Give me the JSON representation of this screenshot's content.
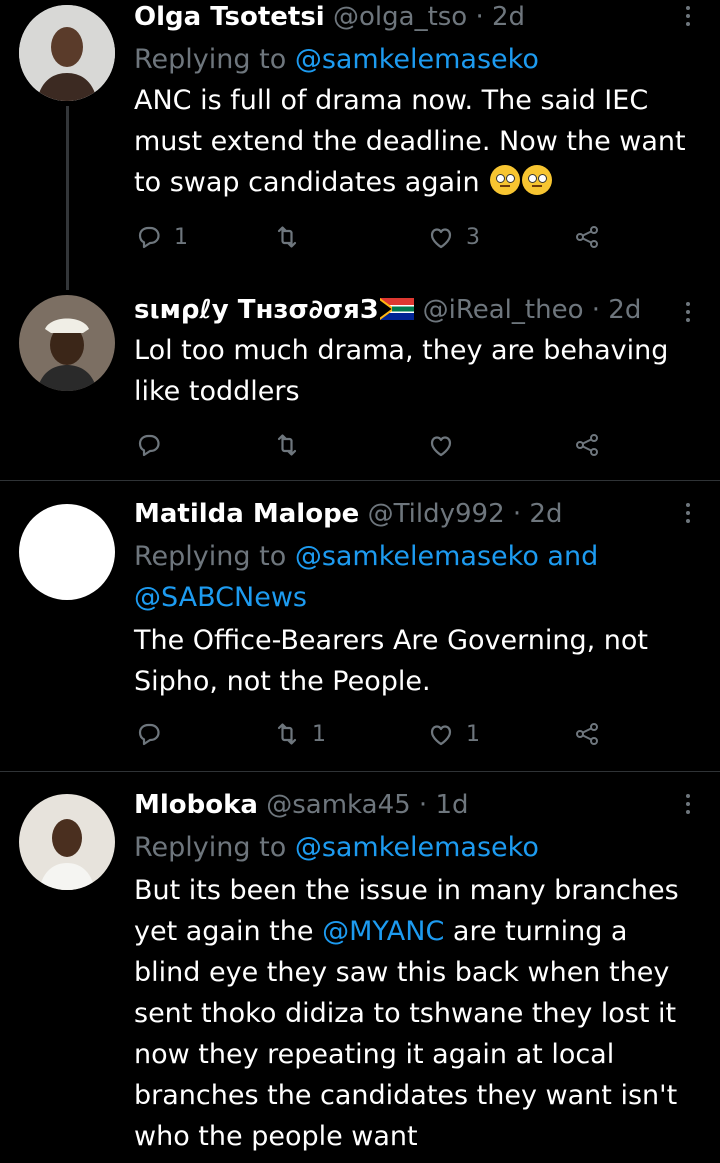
{
  "tweets": [
    {
      "name": "Olga Tsotetsi",
      "handle": "@olga_tso",
      "time": "· 2d",
      "reply_prefix": "Replying to",
      "reply_to": "@samkelemaseko",
      "text": "ANC is full of drama now. The said IEC must extend the deadline. Now the want to swap candidates again",
      "replies": "1",
      "retweets": "",
      "likes": "3"
    },
    {
      "name": "sιмρℓу Tнзσ∂σяЗ",
      "handle": "@iReal_theo",
      "time": "· 2d",
      "text": "Lol too much drama, they are behaving like toddlers",
      "replies": "",
      "retweets": "",
      "likes": ""
    },
    {
      "name": "Matilda Malope",
      "handle": "@Tildy992",
      "time": "· 2d",
      "reply_prefix": "Replying to",
      "reply_to": "@samkelemaseko and @SABCNews",
      "text": "The Office-Bearers Are Governing, not Sipho, not the People.",
      "replies": "",
      "retweets": "1",
      "likes": "1"
    },
    {
      "name": "Mloboka",
      "handle": "@samka45",
      "time": "· 1d",
      "reply_prefix": "Replying to",
      "reply_to": "@samkelemaseko",
      "text_before": "But its been the issue in many branches yet again the",
      "mention": "@MYANC",
      "text_after": "are turning a blind eye they saw this back when they sent thoko didiza to tshwane they lost it now they repeating it again at local branches the candidates they want isn't who the people want"
    }
  ],
  "icons": [
    "reply-icon",
    "retweet-icon",
    "like-icon",
    "share-icon",
    "more-icon"
  ],
  "colors": {
    "background": "#000000",
    "muted": "#6e767d",
    "link": "#1d9bf0",
    "divider": "#2f3336"
  }
}
